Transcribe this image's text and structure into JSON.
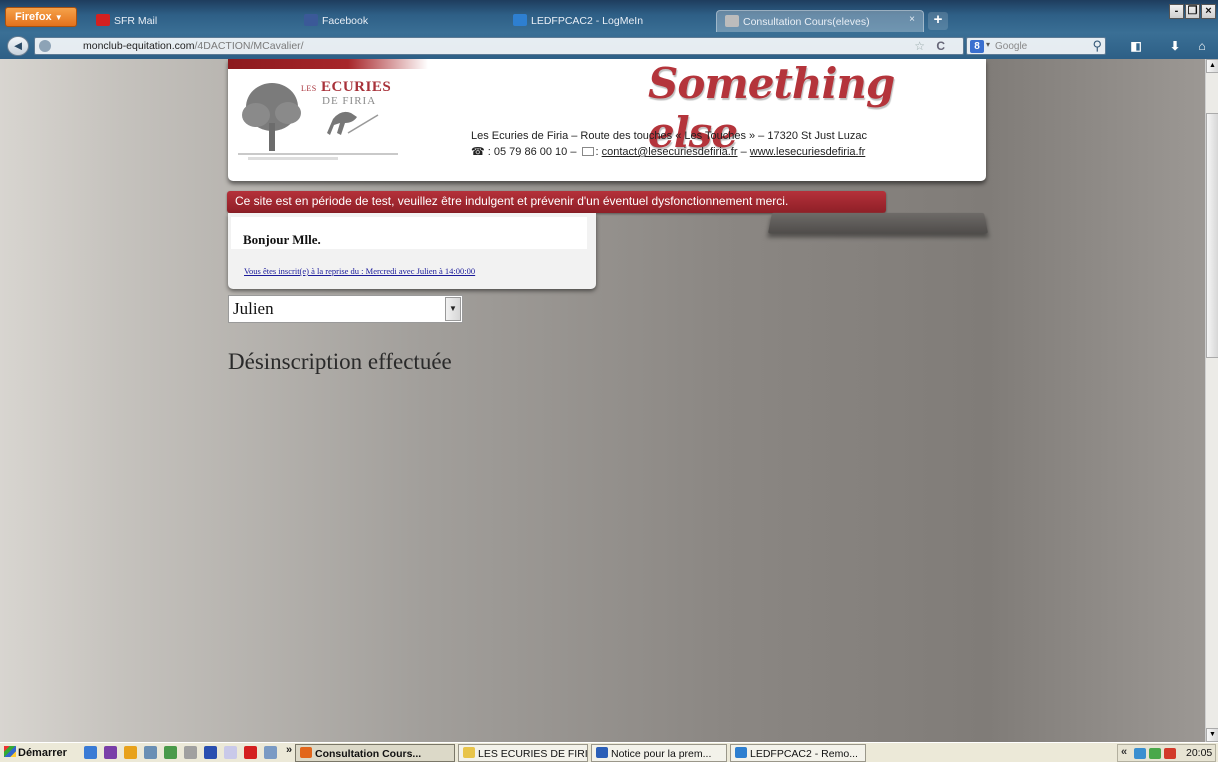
{
  "browser": {
    "menu_label": "Firefox",
    "tabs": [
      {
        "label": "SFR Mail",
        "icon_color": "#d42020"
      },
      {
        "label": "Facebook",
        "icon_color": "#3b5998"
      },
      {
        "label": "LEDFPCAC2 - LogMeIn",
        "icon_color": "#2e7fd0"
      },
      {
        "label": "Consultation Cours(eleves)",
        "icon_color": "#bcbcbc"
      }
    ],
    "tab_close": "×",
    "new_tab": "+",
    "window_controls": [
      "-",
      "❐",
      "×"
    ],
    "url_domain": "monclub-equitation.com",
    "url_path": "/4DACTION/MCavalier/",
    "search_engine_letter": "8",
    "search_placeholder": "Google"
  },
  "header": {
    "logo_line1_prefix": "LES",
    "logo_line1": "ECURIES",
    "logo_line2": "DE FIRIA",
    "slogan": "Something else",
    "address": "Les Ecuries de Firia – Route des touches « Les Touches » – 17320 St Just Luzac",
    "phone_prefix": " : 05 79 86 00 10 – ",
    "mail_sep": ": ",
    "email": "contact@lesecuriesdefiria.fr",
    "dash": " – ",
    "website": "www.lesecuriesdefiria.fr"
  },
  "banner": {
    "text": "Ce site est en période de test, veuillez être indulgent et prévenir d'un éventuel dysfonctionnement merci."
  },
  "greeting": {
    "title": "Bonjour Mlle.",
    "enrollment_link": "Vous êtes inscrit(e) à la reprise du : Mercredi avec Julien à 14:00:00"
  },
  "instructor_select": {
    "selected": "Julien"
  },
  "status": {
    "message": "Désinscription effectuée"
  },
  "taskbar": {
    "start_label": "Démarrer",
    "more": "»",
    "tasks": [
      {
        "label": "Consultation Cours...",
        "icon_color": "#e2661c"
      },
      {
        "label": "LES ECURIES DE FIRIA",
        "icon_color": "#e8c44a"
      },
      {
        "label": "Notice pour la prem...",
        "icon_color": "#2b5fb8"
      },
      {
        "label": "LEDFPCAC2 - Remo...",
        "icon_color": "#2e7fd0"
      }
    ],
    "tray_arrows": "«",
    "clock": "20:05"
  }
}
